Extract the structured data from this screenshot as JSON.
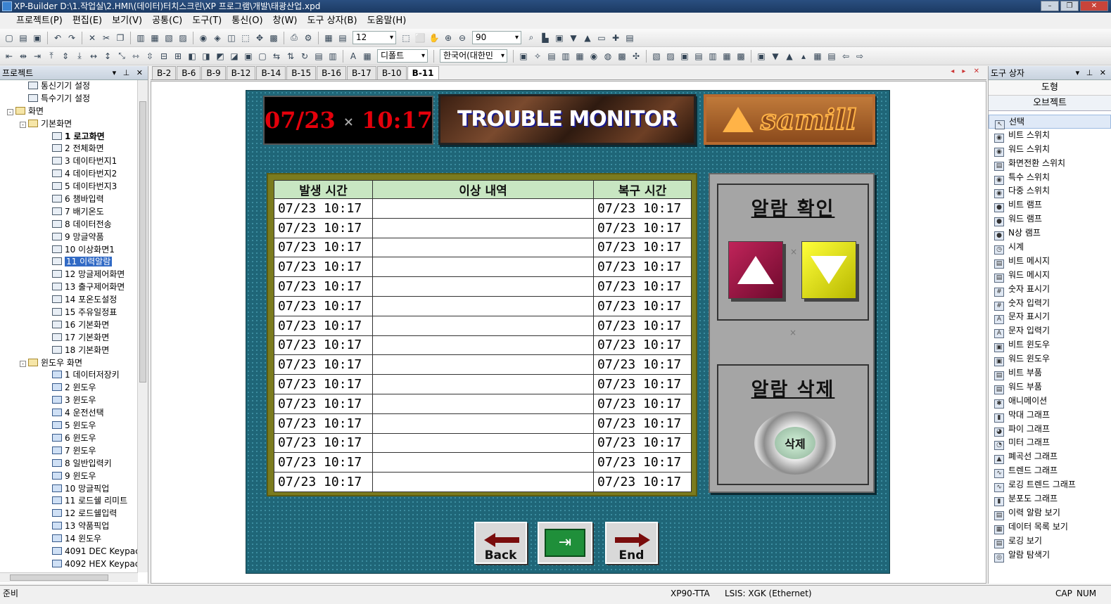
{
  "app_title": "XP-Builder D:\\1.작업실\\2.HMI\\(데이터)터치스크린\\XP 프로그램\\개발\\태광산업.xpd",
  "menu": [
    "프로젝트(P)",
    "편집(E)",
    "보기(V)",
    "공통(C)",
    "도구(T)",
    "통신(O)",
    "창(W)",
    "도구 상자(B)",
    "도움말(H)"
  ],
  "toolbar": {
    "grid_size": "12",
    "zoom": "90",
    "font": "디폴트",
    "language": "한국어(대한민"
  },
  "project_panel": {
    "title": "프로젝트",
    "tree": [
      {
        "label": "통신기기 설정",
        "level": 2,
        "icon": "device"
      },
      {
        "label": "특수기기 설정",
        "level": 2,
        "icon": "device"
      },
      {
        "label": "화면",
        "level": 1,
        "icon": "folder",
        "exp": "-"
      },
      {
        "label": "기본화면",
        "level": 2,
        "icon": "folder",
        "exp": "-"
      },
      {
        "label": "1 로고화면",
        "level": 3,
        "icon": "screen",
        "bold": true
      },
      {
        "label": "2 전체화면",
        "level": 3,
        "icon": "screen"
      },
      {
        "label": "3 데이타번지1",
        "level": 3,
        "icon": "screen"
      },
      {
        "label": "4 데이타번지2",
        "level": 3,
        "icon": "screen"
      },
      {
        "label": "5 데이타번지3",
        "level": 3,
        "icon": "screen"
      },
      {
        "label": "6 챔바입력",
        "level": 3,
        "icon": "screen"
      },
      {
        "label": "7 배기온도",
        "level": 3,
        "icon": "screen"
      },
      {
        "label": "8 데이터전송",
        "level": 3,
        "icon": "screen"
      },
      {
        "label": "9 망글약품",
        "level": 3,
        "icon": "screen"
      },
      {
        "label": "10 이상화면1",
        "level": 3,
        "icon": "screen"
      },
      {
        "label": "11 이력알람",
        "level": 3,
        "icon": "screen",
        "selected": true
      },
      {
        "label": "12 망글제어화면",
        "level": 3,
        "icon": "screen"
      },
      {
        "label": "13 출구제어화면",
        "level": 3,
        "icon": "screen"
      },
      {
        "label": "14 포온도설정",
        "level": 3,
        "icon": "screen"
      },
      {
        "label": "15 주유일정표",
        "level": 3,
        "icon": "screen"
      },
      {
        "label": "16 기본화면",
        "level": 3,
        "icon": "screen"
      },
      {
        "label": "17 기본화면",
        "level": 3,
        "icon": "screen"
      },
      {
        "label": "18 기본화면",
        "level": 3,
        "icon": "screen"
      },
      {
        "label": "윈도우 화면",
        "level": 2,
        "icon": "folder",
        "exp": "-"
      },
      {
        "label": "1 데이터저장키",
        "level": 3,
        "icon": "win"
      },
      {
        "label": "2 윈도우",
        "level": 3,
        "icon": "win"
      },
      {
        "label": "3 윈도우",
        "level": 3,
        "icon": "win"
      },
      {
        "label": "4 운전선택",
        "level": 3,
        "icon": "win"
      },
      {
        "label": "5 윈도우",
        "level": 3,
        "icon": "win"
      },
      {
        "label": "6 윈도우",
        "level": 3,
        "icon": "win"
      },
      {
        "label": "7 윈도우",
        "level": 3,
        "icon": "win"
      },
      {
        "label": "8 일반입력키",
        "level": 3,
        "icon": "win"
      },
      {
        "label": "9 윈도우",
        "level": 3,
        "icon": "win"
      },
      {
        "label": "10 망글픽업",
        "level": 3,
        "icon": "win"
      },
      {
        "label": "11 로드쉘 리미트",
        "level": 3,
        "icon": "win"
      },
      {
        "label": "12 로드쉘입력",
        "level": 3,
        "icon": "win"
      },
      {
        "label": "13 약품픽업",
        "level": 3,
        "icon": "win"
      },
      {
        "label": "14 윈도우",
        "level": 3,
        "icon": "win"
      },
      {
        "label": "4091 DEC Keypac",
        "level": 3,
        "icon": "win"
      },
      {
        "label": "4092 HEX Keypac",
        "level": 3,
        "icon": "win"
      }
    ]
  },
  "tabs": [
    "B-2",
    "B-6",
    "B-9",
    "B-12",
    "B-14",
    "B-15",
    "B-16",
    "B-17",
    "B-10",
    "B-11"
  ],
  "active_tab": "B-11",
  "hmi": {
    "date": "07/23",
    "time": "10:17",
    "title": "TROUBLE MONITOR",
    "logo": "samill",
    "table_headers": [
      "발생 시간",
      "이상 내역",
      "복구 시간"
    ],
    "rows": [
      [
        "07/23 10:17",
        "",
        "07/23 10:17"
      ],
      [
        "07/23 10:17",
        "",
        "07/23 10:17"
      ],
      [
        "07/23 10:17",
        "",
        "07/23 10:17"
      ],
      [
        "07/23 10:17",
        "",
        "07/23 10:17"
      ],
      [
        "07/23 10:17",
        "",
        "07/23 10:17"
      ],
      [
        "07/23 10:17",
        "",
        "07/23 10:17"
      ],
      [
        "07/23 10:17",
        "",
        "07/23 10:17"
      ],
      [
        "07/23 10:17",
        "",
        "07/23 10:17"
      ],
      [
        "07/23 10:17",
        "",
        "07/23 10:17"
      ],
      [
        "07/23 10:17",
        "",
        "07/23 10:17"
      ],
      [
        "07/23 10:17",
        "",
        "07/23 10:17"
      ],
      [
        "07/23 10:17",
        "",
        "07/23 10:17"
      ],
      [
        "07/23 10:17",
        "",
        "07/23 10:17"
      ],
      [
        "07/23 10:17",
        "",
        "07/23 10:17"
      ],
      [
        "07/23 10:17",
        "",
        "07/23 10:17"
      ]
    ],
    "ack_title": "알람 확인",
    "delete_title": "알람 삭제",
    "delete_button": "삭제",
    "back_label": "Back",
    "end_label": "End"
  },
  "toolbox": {
    "title": "도구 상자",
    "tab_shapes": "도형",
    "tab_objects": "오브젝트",
    "items": [
      "선택",
      "비트 스위치",
      "워드 스위치",
      "화면전환 스위치",
      "특수 스위치",
      "다중 스위치",
      "비트 램프",
      "워드 램프",
      "N상 램프",
      "시계",
      "비트 메시지",
      "워드 메시지",
      "숫자 표시기",
      "숫자 입력기",
      "문자 표시기",
      "문자 입력기",
      "비트 윈도우",
      "워드 윈도우",
      "비트 부품",
      "워드 부품",
      "애니메이션",
      "막대 그래프",
      "파이 그래프",
      "미터 그래프",
      "폐곡선 그래프",
      "트렌드 그래프",
      "로깅 트렌드 그래프",
      "분포도 그래프",
      "이력 알람 보기",
      "데이터 목록 보기",
      "로깅 보기",
      "알람 탐색기"
    ]
  },
  "status": {
    "left": "준비",
    "device": "XP90-TTA",
    "plc": "LSIS: XGK (Ethernet)",
    "cap": "CAP",
    "num": "NUM"
  }
}
